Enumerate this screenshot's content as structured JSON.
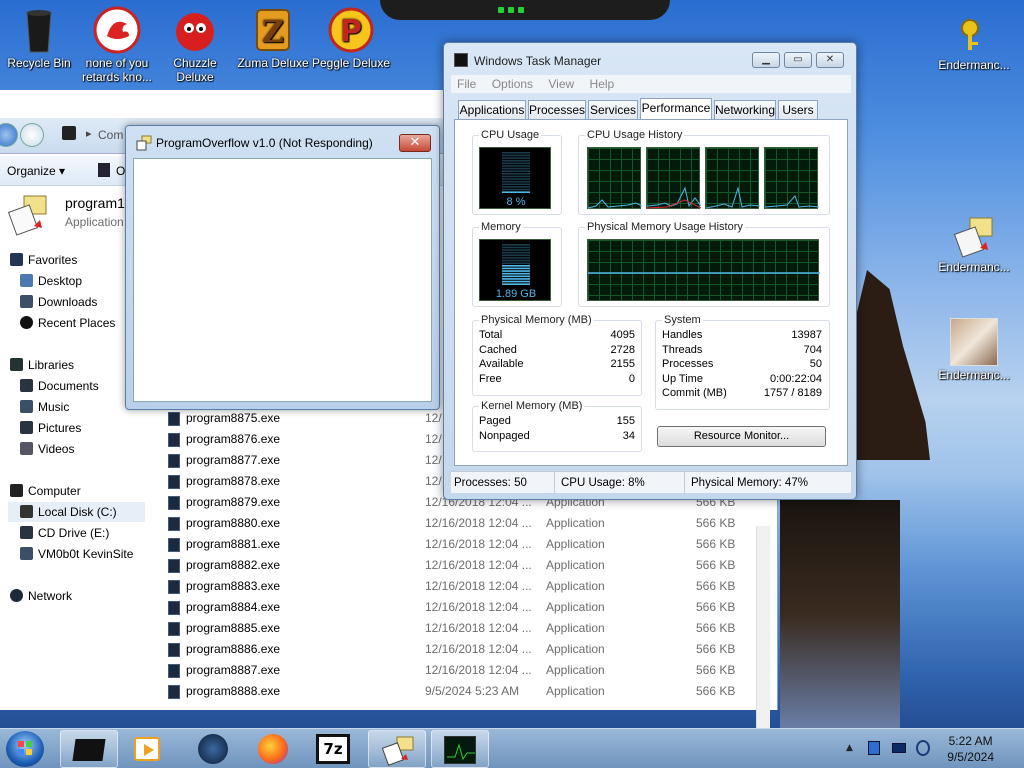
{
  "desktop": {
    "icons": [
      {
        "label": "Recycle Bin",
        "icon": "recycle-bin-icon"
      },
      {
        "label": "none of you retards kno...",
        "icon": "dragon-game-icon"
      },
      {
        "label": "Chuzzle Deluxe",
        "icon": "chuzzle-icon"
      },
      {
        "label": "Zuma Deluxe",
        "icon": "zuma-icon"
      },
      {
        "label": "Peggle Deluxe",
        "icon": "peggle-icon"
      },
      {
        "label": "Endermanc...",
        "icon": "keys-icon"
      },
      {
        "label": "Endermanc...",
        "icon": "program-icon"
      },
      {
        "label": "Endermanc...",
        "icon": "cat-photo-icon"
      }
    ]
  },
  "explorer": {
    "address_segment": "Com",
    "toolbar": {
      "organize": "Organize",
      "open_partial": "O"
    },
    "preview": {
      "name": "program1",
      "type": "Application"
    },
    "nav": {
      "favorites": "Favorites",
      "desktop": "Desktop",
      "downloads": "Downloads",
      "recent": "Recent Places",
      "libraries": "Libraries",
      "documents": "Documents",
      "music": "Music",
      "pictures": "Pictures",
      "videos": "Videos",
      "computer": "Computer",
      "local_disk": "Local Disk (C:)",
      "cd_drive": "CD Drive (E:)",
      "vm": "VM0b0t KevinSite",
      "network": "Network"
    },
    "files": [
      {
        "name": "program8875.exe",
        "date": "12/",
        "type": "",
        "size": ""
      },
      {
        "name": "program8876.exe",
        "date": "12/",
        "type": "",
        "size": ""
      },
      {
        "name": "program8877.exe",
        "date": "12/",
        "type": "",
        "size": ""
      },
      {
        "name": "program8878.exe",
        "date": "12/",
        "type": "",
        "size": ""
      },
      {
        "name": "program8879.exe",
        "date": "12/16/2018 12:04 ...",
        "type": "Application",
        "size": "566 KB"
      },
      {
        "name": "program8880.exe",
        "date": "12/16/2018 12:04 ...",
        "type": "Application",
        "size": "566 KB"
      },
      {
        "name": "program8881.exe",
        "date": "12/16/2018 12:04 ...",
        "type": "Application",
        "size": "566 KB"
      },
      {
        "name": "program8882.exe",
        "date": "12/16/2018 12:04 ...",
        "type": "Application",
        "size": "566 KB"
      },
      {
        "name": "program8883.exe",
        "date": "12/16/2018 12:04 ...",
        "type": "Application",
        "size": "566 KB"
      },
      {
        "name": "program8884.exe",
        "date": "12/16/2018 12:04 ...",
        "type": "Application",
        "size": "566 KB"
      },
      {
        "name": "program8885.exe",
        "date": "12/16/2018 12:04 ...",
        "type": "Application",
        "size": "566 KB"
      },
      {
        "name": "program8886.exe",
        "date": "12/16/2018 12:04 ...",
        "type": "Application",
        "size": "566 KB"
      },
      {
        "name": "program8887.exe",
        "date": "12/16/2018 12:04 ...",
        "type": "Application",
        "size": "566 KB"
      },
      {
        "name": "program8888.exe",
        "date": "9/5/2024 5:23 AM",
        "type": "Application",
        "size": "566 KB"
      }
    ]
  },
  "not_responding": {
    "title": "ProgramOverflow v1.0 (Not Responding)",
    "close": "✕"
  },
  "task_manager": {
    "title": "Windows Task Manager",
    "menu": [
      "File",
      "Options",
      "View",
      "Help"
    ],
    "tabs": [
      "Applications",
      "Processes",
      "Services",
      "Performance",
      "Networking",
      "Users"
    ],
    "active_tab": "Performance",
    "cpu_usage_label": "CPU Usage",
    "cpu_value": "8 %",
    "cpu_percent": 8,
    "cpu_history_label": "CPU Usage History",
    "memory_label": "Memory",
    "memory_value": "1.89 GB",
    "memory_percent": 47,
    "mem_history_label": "Physical Memory Usage History",
    "physical": {
      "label": "Physical Memory (MB)",
      "rows": [
        [
          "Total",
          "4095"
        ],
        [
          "Cached",
          "2728"
        ],
        [
          "Available",
          "2155"
        ],
        [
          "Free",
          "0"
        ]
      ]
    },
    "kernel": {
      "label": "Kernel Memory (MB)",
      "rows": [
        [
          "Paged",
          "155"
        ],
        [
          "Nonpaged",
          "34"
        ]
      ]
    },
    "system": {
      "label": "System",
      "rows": [
        [
          "Handles",
          "13987"
        ],
        [
          "Threads",
          "704"
        ],
        [
          "Processes",
          "50"
        ],
        [
          "Up Time",
          "0:00:22:04"
        ],
        [
          "Commit (MB)",
          "1757 / 8189"
        ]
      ]
    },
    "resource_monitor": "Resource Monitor...",
    "status": {
      "processes": "Processes: 50",
      "cpu": "CPU Usage: 8%",
      "memory": "Physical Memory: 47%"
    }
  },
  "taskbar": {
    "time": "5:22 AM",
    "date": "9/5/2024"
  },
  "colors": {
    "graph_green": "#27d039",
    "graph_blue": "#4fb6e8",
    "accent": "#2f63ae"
  }
}
